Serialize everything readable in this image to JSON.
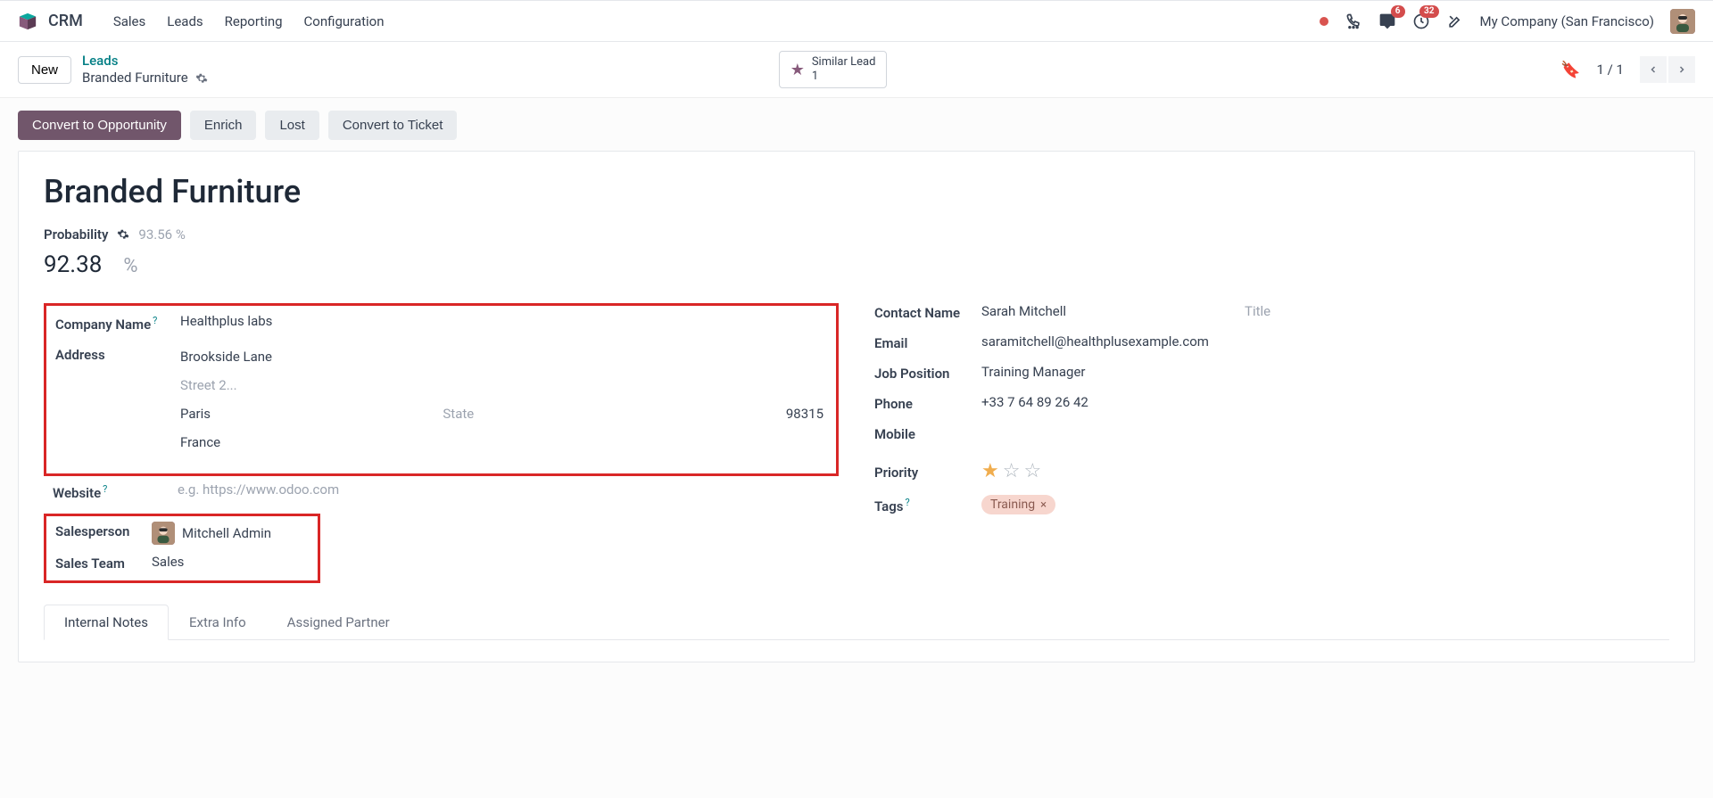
{
  "topbar": {
    "app": "CRM",
    "nav": [
      "Sales",
      "Leads",
      "Reporting",
      "Configuration"
    ],
    "badge_chat": "6",
    "badge_clock": "32",
    "company": "My Company (San Francisco)"
  },
  "breadcrumb": {
    "new_btn": "New",
    "parent": "Leads",
    "current": "Branded Furniture",
    "smart_label": "Similar Lead",
    "smart_count": "1",
    "pager": "1 / 1"
  },
  "actions": {
    "convert_opp": "Convert to Opportunity",
    "enrich": "Enrich",
    "lost": "Lost",
    "convert_ticket": "Convert to Ticket"
  },
  "record": {
    "title": "Branded Furniture",
    "prob_label": "Probability",
    "prob_auto": "93.56 %",
    "prob_value": "92.38",
    "prob_unit": "%"
  },
  "left": {
    "company_label": "Company Name",
    "company_val": "Healthplus labs",
    "address_label": "Address",
    "street": "Brookside Lane",
    "street2_ph": "Street 2...",
    "city": "Paris",
    "state_ph": "State",
    "zip": "98315",
    "country": "France",
    "website_label": "Website",
    "website_ph": "e.g. https://www.odoo.com",
    "salesperson_label": "Salesperson",
    "salesperson_val": "Mitchell Admin",
    "team_label": "Sales Team",
    "team_val": "Sales"
  },
  "right": {
    "contact_label": "Contact Name",
    "contact_val": "Sarah Mitchell",
    "title_ph": "Title",
    "email_label": "Email",
    "email_val": "saramitchell@healthplusexample.com",
    "job_label": "Job Position",
    "job_val": "Training Manager",
    "phone_label": "Phone",
    "phone_val": "+33 7 64 89 26 42",
    "mobile_label": "Mobile",
    "priority_label": "Priority",
    "tags_label": "Tags",
    "tag_val": "Training"
  },
  "tabs": {
    "t1": "Internal Notes",
    "t2": "Extra Info",
    "t3": "Assigned Partner"
  }
}
